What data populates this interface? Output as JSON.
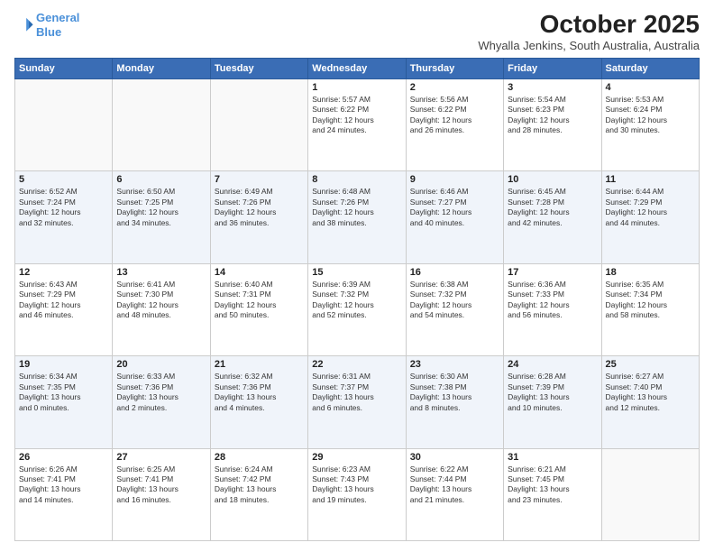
{
  "header": {
    "logo_line1": "General",
    "logo_line2": "Blue",
    "month": "October 2025",
    "location": "Whyalla Jenkins, South Australia, Australia"
  },
  "weekdays": [
    "Sunday",
    "Monday",
    "Tuesday",
    "Wednesday",
    "Thursday",
    "Friday",
    "Saturday"
  ],
  "weeks": [
    [
      {
        "day": "",
        "info": ""
      },
      {
        "day": "",
        "info": ""
      },
      {
        "day": "",
        "info": ""
      },
      {
        "day": "1",
        "info": "Sunrise: 5:57 AM\nSunset: 6:22 PM\nDaylight: 12 hours\nand 24 minutes."
      },
      {
        "day": "2",
        "info": "Sunrise: 5:56 AM\nSunset: 6:22 PM\nDaylight: 12 hours\nand 26 minutes."
      },
      {
        "day": "3",
        "info": "Sunrise: 5:54 AM\nSunset: 6:23 PM\nDaylight: 12 hours\nand 28 minutes."
      },
      {
        "day": "4",
        "info": "Sunrise: 5:53 AM\nSunset: 6:24 PM\nDaylight: 12 hours\nand 30 minutes."
      }
    ],
    [
      {
        "day": "5",
        "info": "Sunrise: 6:52 AM\nSunset: 7:24 PM\nDaylight: 12 hours\nand 32 minutes."
      },
      {
        "day": "6",
        "info": "Sunrise: 6:50 AM\nSunset: 7:25 PM\nDaylight: 12 hours\nand 34 minutes."
      },
      {
        "day": "7",
        "info": "Sunrise: 6:49 AM\nSunset: 7:26 PM\nDaylight: 12 hours\nand 36 minutes."
      },
      {
        "day": "8",
        "info": "Sunrise: 6:48 AM\nSunset: 7:26 PM\nDaylight: 12 hours\nand 38 minutes."
      },
      {
        "day": "9",
        "info": "Sunrise: 6:46 AM\nSunset: 7:27 PM\nDaylight: 12 hours\nand 40 minutes."
      },
      {
        "day": "10",
        "info": "Sunrise: 6:45 AM\nSunset: 7:28 PM\nDaylight: 12 hours\nand 42 minutes."
      },
      {
        "day": "11",
        "info": "Sunrise: 6:44 AM\nSunset: 7:29 PM\nDaylight: 12 hours\nand 44 minutes."
      }
    ],
    [
      {
        "day": "12",
        "info": "Sunrise: 6:43 AM\nSunset: 7:29 PM\nDaylight: 12 hours\nand 46 minutes."
      },
      {
        "day": "13",
        "info": "Sunrise: 6:41 AM\nSunset: 7:30 PM\nDaylight: 12 hours\nand 48 minutes."
      },
      {
        "day": "14",
        "info": "Sunrise: 6:40 AM\nSunset: 7:31 PM\nDaylight: 12 hours\nand 50 minutes."
      },
      {
        "day": "15",
        "info": "Sunrise: 6:39 AM\nSunset: 7:32 PM\nDaylight: 12 hours\nand 52 minutes."
      },
      {
        "day": "16",
        "info": "Sunrise: 6:38 AM\nSunset: 7:32 PM\nDaylight: 12 hours\nand 54 minutes."
      },
      {
        "day": "17",
        "info": "Sunrise: 6:36 AM\nSunset: 7:33 PM\nDaylight: 12 hours\nand 56 minutes."
      },
      {
        "day": "18",
        "info": "Sunrise: 6:35 AM\nSunset: 7:34 PM\nDaylight: 12 hours\nand 58 minutes."
      }
    ],
    [
      {
        "day": "19",
        "info": "Sunrise: 6:34 AM\nSunset: 7:35 PM\nDaylight: 13 hours\nand 0 minutes."
      },
      {
        "day": "20",
        "info": "Sunrise: 6:33 AM\nSunset: 7:36 PM\nDaylight: 13 hours\nand 2 minutes."
      },
      {
        "day": "21",
        "info": "Sunrise: 6:32 AM\nSunset: 7:36 PM\nDaylight: 13 hours\nand 4 minutes."
      },
      {
        "day": "22",
        "info": "Sunrise: 6:31 AM\nSunset: 7:37 PM\nDaylight: 13 hours\nand 6 minutes."
      },
      {
        "day": "23",
        "info": "Sunrise: 6:30 AM\nSunset: 7:38 PM\nDaylight: 13 hours\nand 8 minutes."
      },
      {
        "day": "24",
        "info": "Sunrise: 6:28 AM\nSunset: 7:39 PM\nDaylight: 13 hours\nand 10 minutes."
      },
      {
        "day": "25",
        "info": "Sunrise: 6:27 AM\nSunset: 7:40 PM\nDaylight: 13 hours\nand 12 minutes."
      }
    ],
    [
      {
        "day": "26",
        "info": "Sunrise: 6:26 AM\nSunset: 7:41 PM\nDaylight: 13 hours\nand 14 minutes."
      },
      {
        "day": "27",
        "info": "Sunrise: 6:25 AM\nSunset: 7:41 PM\nDaylight: 13 hours\nand 16 minutes."
      },
      {
        "day": "28",
        "info": "Sunrise: 6:24 AM\nSunset: 7:42 PM\nDaylight: 13 hours\nand 18 minutes."
      },
      {
        "day": "29",
        "info": "Sunrise: 6:23 AM\nSunset: 7:43 PM\nDaylight: 13 hours\nand 19 minutes."
      },
      {
        "day": "30",
        "info": "Sunrise: 6:22 AM\nSunset: 7:44 PM\nDaylight: 13 hours\nand 21 minutes."
      },
      {
        "day": "31",
        "info": "Sunrise: 6:21 AM\nSunset: 7:45 PM\nDaylight: 13 hours\nand 23 minutes."
      },
      {
        "day": "",
        "info": ""
      }
    ]
  ]
}
